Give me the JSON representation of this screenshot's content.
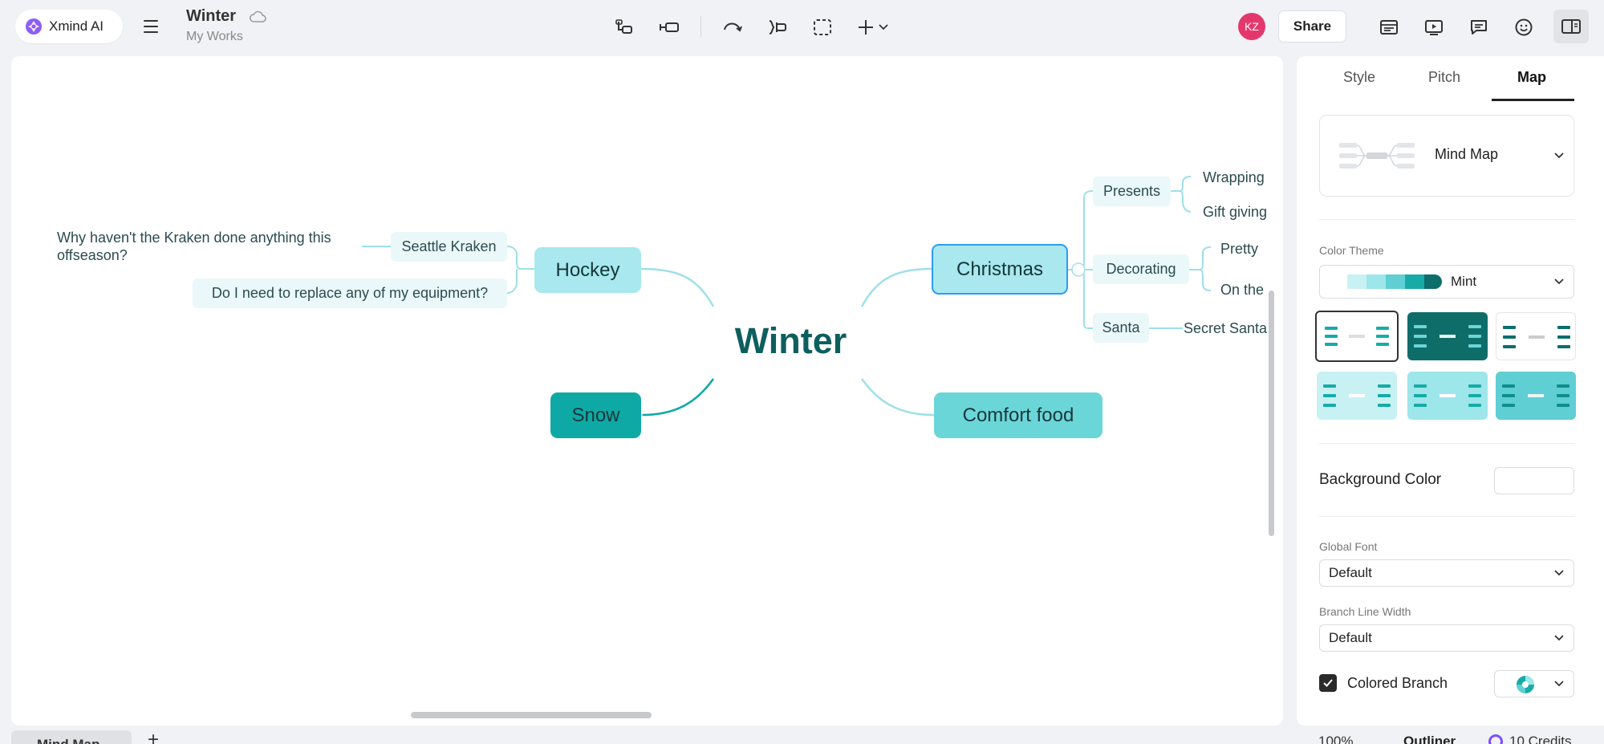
{
  "app": {
    "brand": "Xmind AI",
    "doc_title": "Winter",
    "doc_location": "My Works"
  },
  "user": {
    "initials": "KZ",
    "avatar_color": "#e4386d"
  },
  "header": {
    "share_label": "Share"
  },
  "toolbar_icons": [
    "subtopic-icon",
    "topic-icon",
    "relationship-icon",
    "summary-icon",
    "boundary-icon",
    "insert-icon"
  ],
  "right_toolbar_icons": [
    "format-icon",
    "pitch-icon",
    "comments-icon",
    "emoji-icon",
    "panel-toggle-icon"
  ],
  "map": {
    "central": "Winter",
    "topics": {
      "hockey": "Hockey",
      "snow": "Snow",
      "christmas": "Christmas",
      "comfort": "Comfort food"
    },
    "hockey_children": {
      "kraken": "Seattle Kraken",
      "equipment": "Do I need to replace any of my equipment?",
      "kraken_note_line1": "Why haven't the Kraken done anything this",
      "kraken_note_line2": "offseason?"
    },
    "christmas_children": {
      "presents": "Presents",
      "decorating": "Decorating",
      "santa": "Santa",
      "wrapping": "Wrapping",
      "gift": "Gift giving",
      "pretty": "Pretty",
      "onthe": "On the",
      "secret": "Secret Santa"
    }
  },
  "panel": {
    "tabs": [
      "Style",
      "Pitch",
      "Map"
    ],
    "active_tab": "Map",
    "structure": "Mind Map",
    "color_theme_label": "Color Theme",
    "color_theme_value": "Mint",
    "mint_swatch": [
      "#c8f1f3",
      "#9de6ea",
      "#5fcfd4",
      "#17aba8",
      "#0d6e6b"
    ],
    "background_color_label": "Background Color",
    "global_font_label": "Global Font",
    "global_font_value": "Default",
    "branch_line_width_label": "Branch Line Width",
    "branch_line_width_value": "Default",
    "colored_branch_label": "Colored Branch",
    "colored_branch_checked": true
  },
  "colors": {
    "accent": "#0fa9a5",
    "central_text": "#0d5f5e",
    "hockey_fill": "#a8e8ee",
    "christmas_fill": "#a8e8ee",
    "christmas_border": "#2f9bf0",
    "snow_fill": "#0fa9a5",
    "comfort_fill": "#6bd6d8",
    "branch_line": "#9ee0e8"
  },
  "bottom": {
    "sheet_tab": "Mind Map",
    "zoom": "100%",
    "outliner": "Outliner",
    "credits": "10 Credits"
  }
}
